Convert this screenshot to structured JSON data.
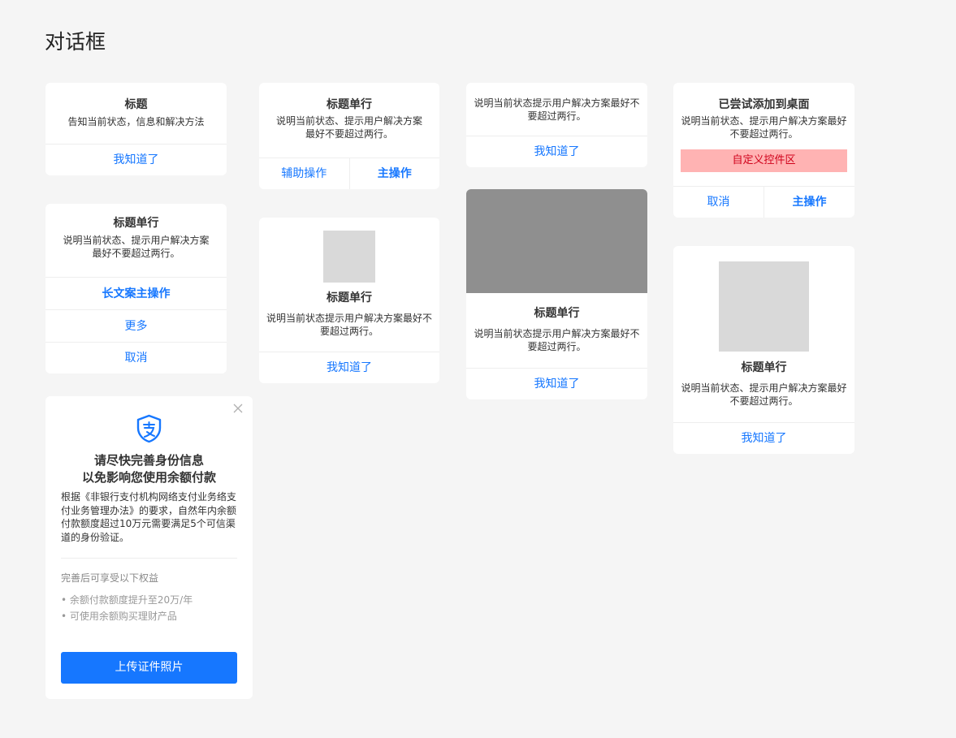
{
  "page": {
    "title": "对话框"
  },
  "dialog1": {
    "title": "标题",
    "desc": "告知当前状态，信息和解决方法",
    "button": "我知道了"
  },
  "dialog2": {
    "title": "标题单行",
    "desc_line1": "说明当前状态、提示用户解决方案",
    "desc_line2": "最好不要超过两行。",
    "button_primary": "长文案主操作",
    "button_more": "更多",
    "button_cancel": "取消"
  },
  "dialog3": {
    "title_line1": "请尽快完善身份信息",
    "title_line2": "以免影响您使用余额付款",
    "icon": "alipay-shield-icon",
    "body_lines": [
      "根据《非银行支付机构网络支付业务络支",
      "付业务管理办法》的要求，自然年内余额",
      "付款额度超过10万元需要满足5个可信渠",
      "道的身份验证。"
    ],
    "benefits_title": "完善后可享受以下权益",
    "benefits": [
      "余额付款额度提升至20万/年",
      "可使用余额购买理财产品"
    ],
    "button": "上传证件照片",
    "close_icon": "close-icon"
  },
  "dialog4": {
    "title": "标题单行",
    "desc_line1": "说明当前状态、提示用户解决方案",
    "desc_line2": "最好不要超过两行。",
    "button_secondary": "辅助操作",
    "button_primary": "主操作"
  },
  "dialog5": {
    "title": "标题单行",
    "desc_line1": "说明当前状态提示用户解决方案最好不",
    "desc_line2": "要超过两行。",
    "button": "我知道了"
  },
  "dialog6": {
    "desc_line1": "说明当前状态提示用户解决方案最好不",
    "desc_line2": "要超过两行。",
    "button": "我知道了"
  },
  "dialog7": {
    "title": "标题单行",
    "desc_line1": "说明当前状态提示用户解决方案最好不",
    "desc_line2": "要超过两行。",
    "button": "我知道了"
  },
  "dialog8": {
    "title": "已尝试添加到桌面",
    "desc_line1": "说明当前状态、提示用户解决方案最好",
    "desc_line2": "不要超过两行。",
    "custom_area": "自定义控件区",
    "button_cancel": "取消",
    "button_primary": "主操作"
  },
  "dialog9": {
    "title": "标题单行",
    "desc_line1": "说明当前状态、提示用户解决方案最好",
    "desc_line2": "不要超过两行。",
    "button": "我知道了"
  },
  "colors": {
    "accent": "#1677ff",
    "background": "#f5f5f5",
    "placeholder": "#d9d9d9",
    "image_dark": "#8f8f8f",
    "custom_area_bg": "#ffb3b3",
    "custom_area_text": "#d0021b"
  }
}
